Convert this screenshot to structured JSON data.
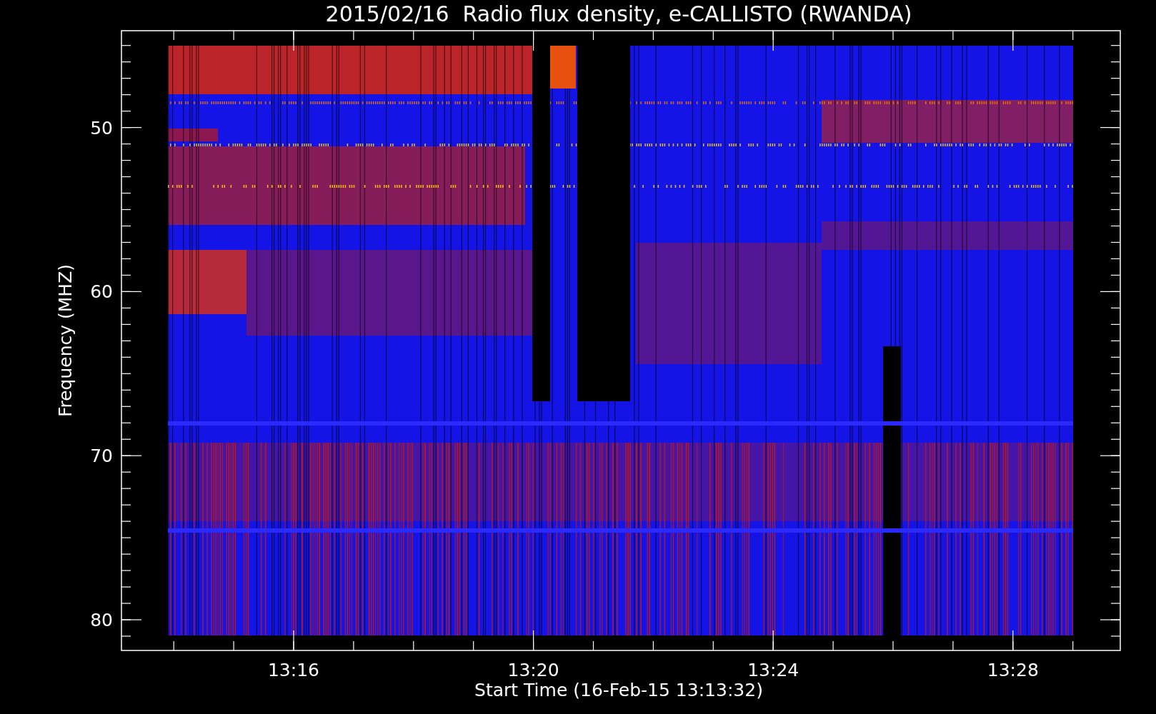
{
  "title": "2015/02/16  Radio flux density, e-CALLISTO (RWANDA)",
  "y_axis": {
    "label": "Frequency (MHZ)",
    "ticks": [
      "50",
      "60",
      "70",
      "80"
    ]
  },
  "x_axis": {
    "label": "Start Time (16-Feb-15 13:13:32)",
    "ticks": [
      "13:16",
      "13:20",
      "13:24",
      "13:28"
    ]
  }
}
